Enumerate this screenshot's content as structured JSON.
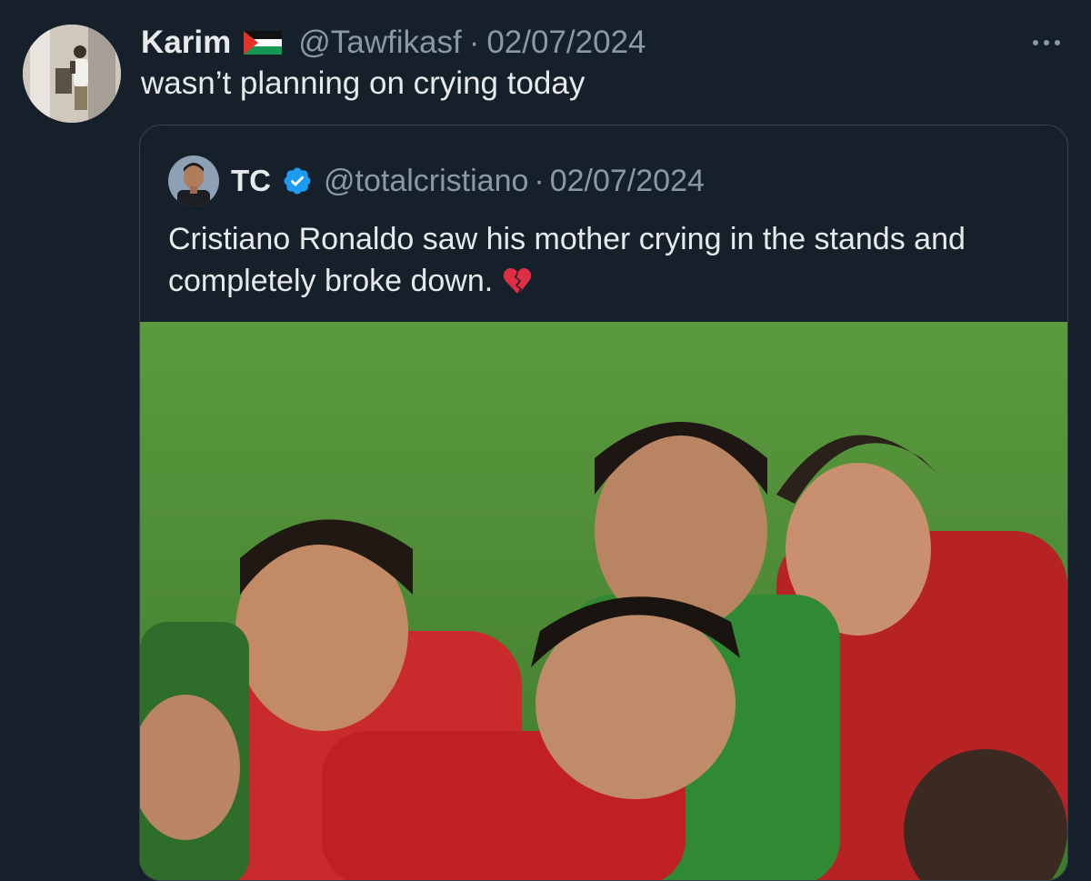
{
  "tweet": {
    "author_name": "Karim",
    "author_flag": "palestine-flag-icon",
    "handle": "@Tawfikasf",
    "separator": "·",
    "date": "02/07/2024",
    "text": "wasn’t planning on crying today"
  },
  "quoted_tweet": {
    "author_name": "TC",
    "handle": "@totalcristiano",
    "separator": "·",
    "date": "02/07/2024",
    "text": "Cristiano Ronaldo saw his mother crying in the stands and completely broke down.",
    "emoji": "broken-heart-icon",
    "verified": true,
    "media_description": "photo"
  },
  "colors": {
    "background": "#15202b",
    "text_primary": "#e7e9ea",
    "text_secondary": "#8b98a5",
    "verified_blue": "#1d9bf0",
    "border": "#38444d"
  }
}
